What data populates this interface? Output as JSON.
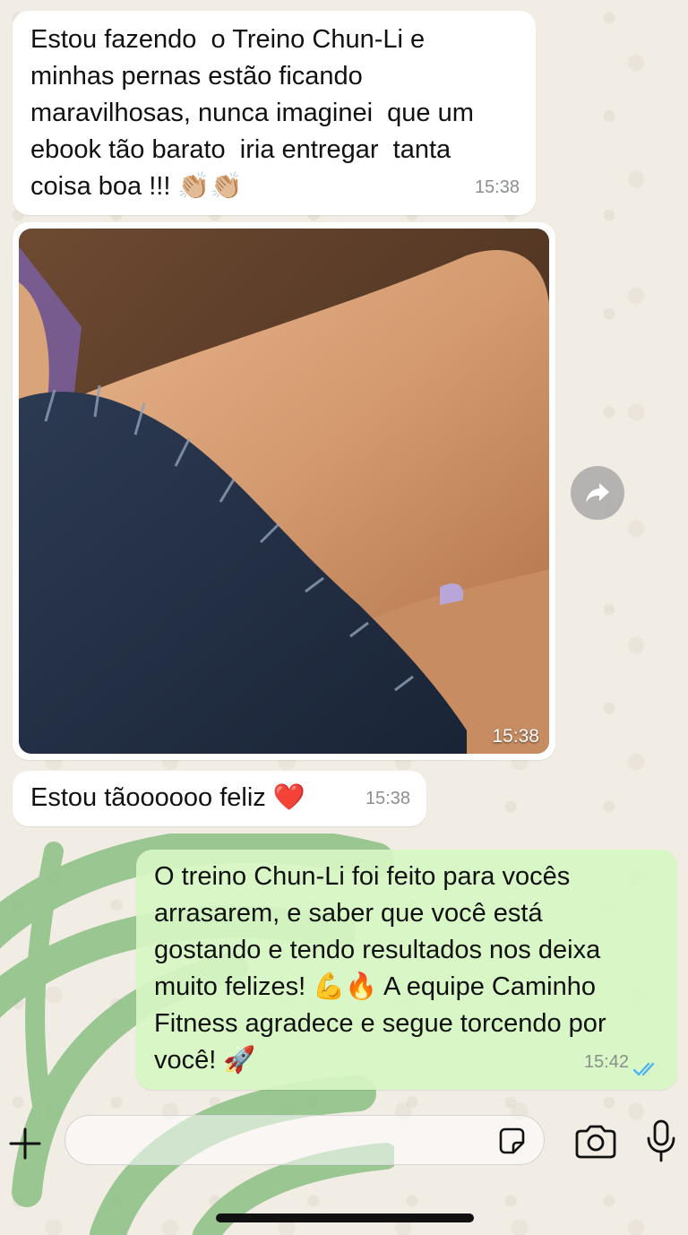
{
  "messages": [
    {
      "id": "msg1",
      "direction": "incoming",
      "text": "Estou fazendo  o Treino Chun-Li e\nminhas pernas estão ficando\nmaravilhosas, nunca imaginei  que um\nebook tão barato  iria entregar  tanta\ncoisa boa !!! 👏🏼👏🏼",
      "time": "15:38"
    },
    {
      "id": "msg2",
      "direction": "incoming",
      "type": "photo",
      "time": "15:38"
    },
    {
      "id": "msg3",
      "direction": "incoming",
      "text": "Estou tãoooooo feliz ❤️",
      "time": "15:38"
    },
    {
      "id": "msg4",
      "direction": "outgoing",
      "text": "O treino Chun-Li foi feito para vocês\narrasarem, e saber que você está\ngostando e tendo resultados nos deixa\nmuito felizes! 💪🔥 A equipe Caminho\nFitness agradece e segue torcendo por\nvocê! 🚀",
      "time": "15:42",
      "status": "read"
    }
  ],
  "icons": {
    "forward": "forward-arrow-icon",
    "plus": "plus-icon",
    "sticker": "sticker-icon",
    "camera": "camera-icon",
    "mic": "microphone-icon",
    "read_receipt": "double-check-icon"
  },
  "colors": {
    "outgoing_bubble": "#d6f6c4",
    "incoming_bubble": "#ffffff",
    "read_ticks": "#4fb3f6",
    "watermark": "#8cc084"
  }
}
